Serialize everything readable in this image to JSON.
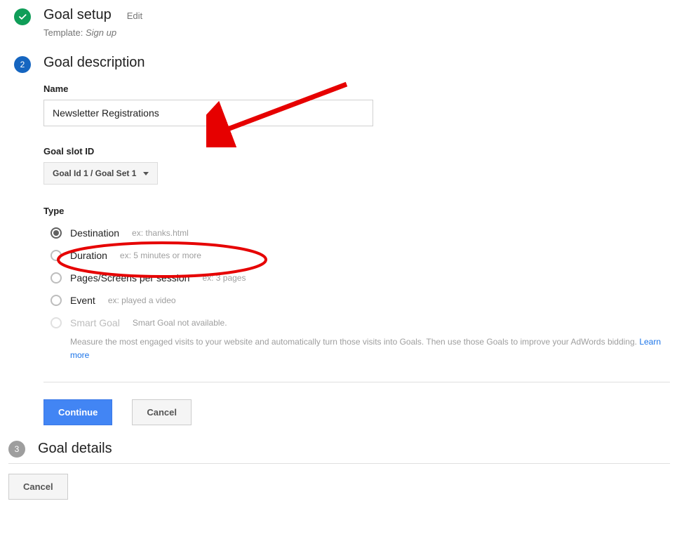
{
  "step1": {
    "title": "Goal setup",
    "edit_label": "Edit",
    "template_prefix": "Template:",
    "template_value": "Sign up"
  },
  "step2": {
    "number": "2",
    "title": "Goal description",
    "name_label": "Name",
    "name_value": "Newsletter Registrations",
    "slot_label": "Goal slot ID",
    "slot_value": "Goal Id 1 / Goal Set 1",
    "type_label": "Type",
    "types": [
      {
        "label": "Destination",
        "hint": "ex: thanks.html",
        "selected": true,
        "disabled": false
      },
      {
        "label": "Duration",
        "hint": "ex: 5 minutes or more",
        "selected": false,
        "disabled": false
      },
      {
        "label": "Pages/Screens per session",
        "hint": "ex: 3 pages",
        "selected": false,
        "disabled": false
      },
      {
        "label": "Event",
        "hint": "ex: played a video",
        "selected": false,
        "disabled": false
      },
      {
        "label": "Smart Goal",
        "hint": "Smart Goal not available.",
        "selected": false,
        "disabled": true
      }
    ],
    "smart_desc": "Measure the most engaged visits to your website and automatically turn those visits into Goals. Then use those Goals to improve your AdWords bidding.",
    "learn_more": "Learn more",
    "continue_label": "Continue",
    "cancel_label": "Cancel"
  },
  "step3": {
    "number": "3",
    "title": "Goal details"
  },
  "footer": {
    "cancel_label": "Cancel"
  }
}
